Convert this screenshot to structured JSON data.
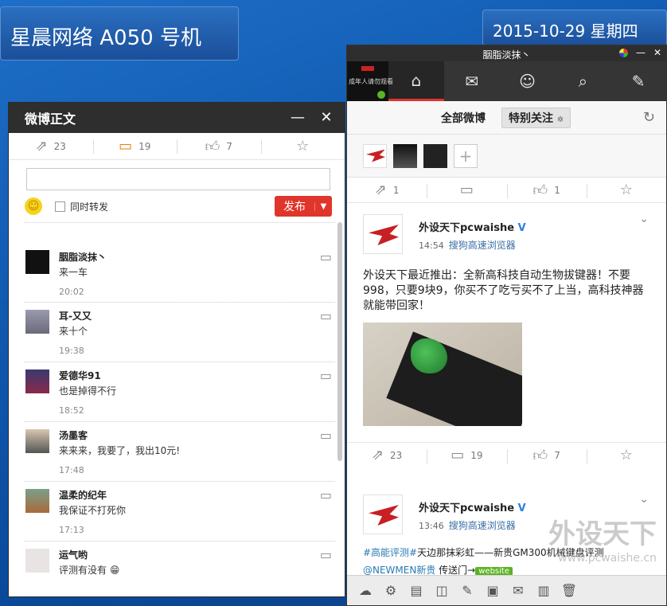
{
  "desktop": {
    "machine_label": "星晨网络 A050 号机",
    "date_label": "2015-10-29 星期四"
  },
  "comment_window": {
    "title": "微博正文",
    "minimize": "—",
    "close": "✕",
    "actions": [
      {
        "icon": "share-icon",
        "count": "23"
      },
      {
        "icon": "comment-icon",
        "count": "19"
      },
      {
        "icon": "like-icon",
        "count": "7"
      },
      {
        "icon": "favorite-icon",
        "count": ""
      }
    ],
    "input_placeholder": "",
    "repost_label": "同时转发",
    "publish_label": "发布",
    "comments": [
      {
        "name": "胭脂淡抹丶",
        "text": "来一车",
        "time": "20:02"
      },
      {
        "name": "耳-又又",
        "text": "来十个",
        "time": "19:38"
      },
      {
        "name": "爱德华91",
        "text": "也是掉得不行",
        "time": "18:52"
      },
      {
        "name": "汤墨客",
        "text": "来来来，我要了，我出10元!",
        "time": "17:48"
      },
      {
        "name": "温柔的纪年",
        "text": "我保证不打死你",
        "time": "17:13"
      },
      {
        "name": "运气哟",
        "text": "评测有没有",
        "time": ""
      }
    ]
  },
  "weibo_window": {
    "title": "胭脂淡抹丶",
    "avatar_text": "成年人请勿观看",
    "nav_tabs": [
      "home-icon",
      "mail-icon",
      "profile-icon",
      "search-icon",
      "edit-icon"
    ],
    "filter": {
      "all": "全部微博",
      "special": "特别关注"
    },
    "top_actions": [
      {
        "icon": "share-icon",
        "count": "1"
      },
      {
        "icon": "comment-icon",
        "count": ""
      },
      {
        "icon": "like-icon",
        "count": "1"
      },
      {
        "icon": "favorite-icon",
        "count": ""
      }
    ],
    "posts": [
      {
        "author": "外设天下pcwaishe",
        "verified": "V",
        "time": "14:54",
        "source": "搜狗高速浏览器",
        "body": "外设天下最近推出：全新高科技自动生物拔键器！不要998，只要9块9，你买不了吃亏买不了上当，高科技神器就能带回家！",
        "actions": [
          {
            "icon": "share-icon",
            "count": "23"
          },
          {
            "icon": "comment-icon",
            "count": "19"
          },
          {
            "icon": "like-icon",
            "count": "7"
          },
          {
            "icon": "favorite-icon",
            "count": ""
          }
        ]
      },
      {
        "author": "外设天下pcwaishe",
        "verified": "V",
        "time": "13:46",
        "source": "搜狗高速浏览器",
        "tag1": "#高能评测#",
        "body_part": "天边那抹彩虹——新贵GM300机械键盘评测",
        "mention": "@NEWMEN新贵",
        "link_text": "传送门→",
        "link_badge": "website"
      }
    ],
    "watermark": "外设天下",
    "watermark_url": "www.pcwaishe.cn"
  }
}
